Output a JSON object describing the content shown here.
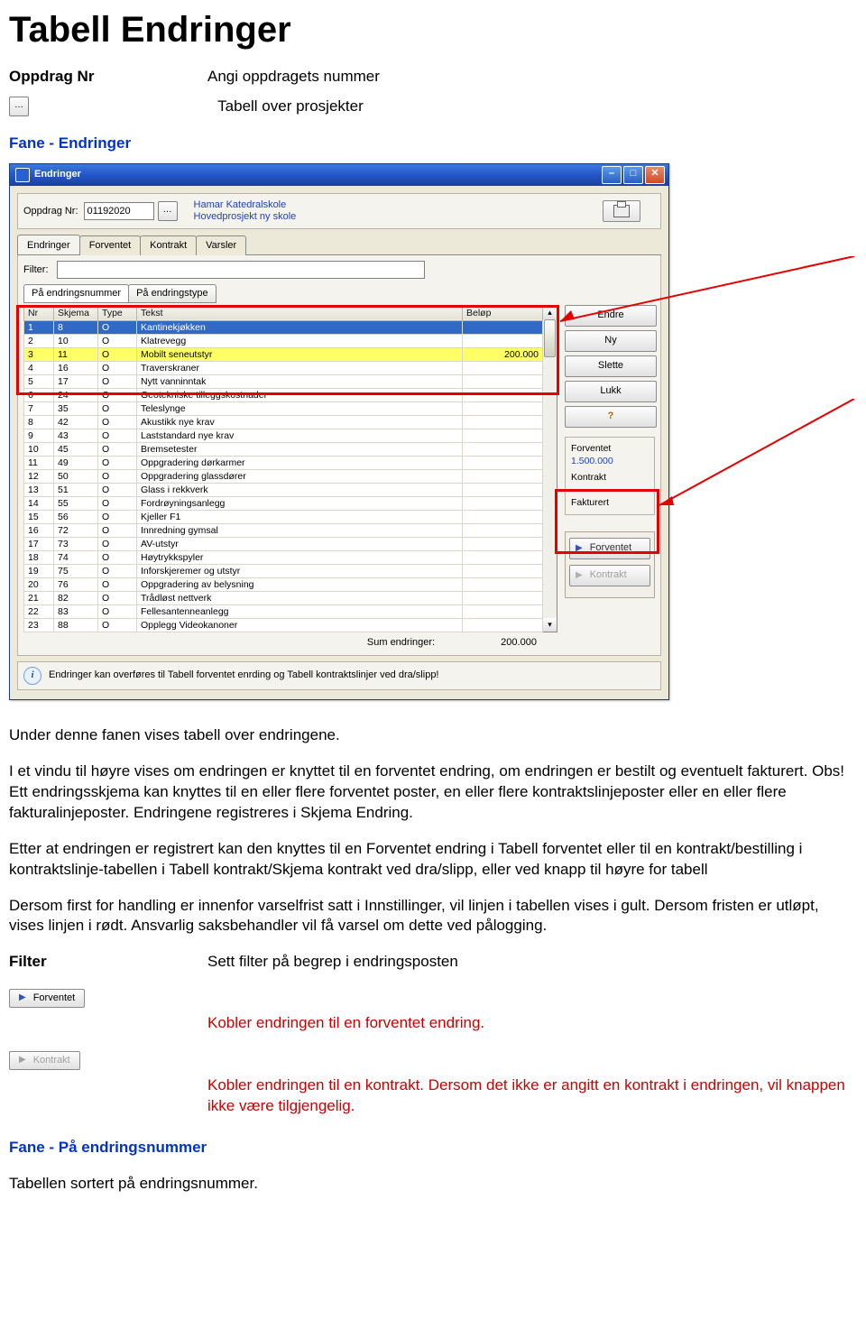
{
  "doc": {
    "title": "Tabell Endringer",
    "defs": {
      "oppdrag_label": "Oppdrag Nr",
      "oppdrag_desc": "Angi oppdragets nummer",
      "tabell_desc": "Tabell over prosjekter"
    },
    "section1_heading": "Fane - Endringer",
    "para1": "Under denne fanen vises tabell over endringene.",
    "para2": "I et vindu til høyre vises om endringen er knyttet til en forventet endring, om endringen er bestilt og eventuelt fakturert. Obs! Ett endringsskjema kan knyttes til en eller flere forventet poster, en eller flere kontraktslinjeposter eller en eller flere fakturalinjeposter. Endringene registreres i Skjema Endring.",
    "para3": "Etter at endringen er registrert kan den knyttes til en Forventet endring i Tabell forventet eller til en kontrakt/bestilling i kontraktslinje-tabellen i Tabell kontrakt/Skjema kontrakt ved dra/slipp, eller ved knapp til høyre for tabell",
    "para4": "Dersom first for handling er innenfor varselfrist satt i Innstillinger, vil linjen i tabellen vises i gult. Dersom fristen er utløpt, vises linjen i rødt. Ansvarlig saksbehandler vil få varsel om dette ved pålogging.",
    "filter_label": "Filter",
    "filter_desc": "Sett filter på begrep i endringsposten",
    "forventet_text": "Kobler endringen til en forventet endring.",
    "kontrakt_text": "Kobler endringen til en kontrakt. Dersom det ikke er angitt en kontrakt i endringen, vil knappen ikke være tilgjengelig.",
    "section2_heading": "Fane - På endringsnummer",
    "section2_text": "Tabellen sortert på endringsnummer.",
    "btn_forventet": "Forventet",
    "btn_kontrakt": "Kontrakt"
  },
  "win": {
    "title": "Endringer",
    "oppdrag_label": "Oppdrag Nr:",
    "oppdrag_value": "01192020",
    "project_line1": "Hamar Katedralskole",
    "project_line2": "Hovedprosjekt ny skole",
    "tabs": [
      "Endringer",
      "Forventet",
      "Kontrakt",
      "Varsler"
    ],
    "filter_label": "Filter:",
    "subtabs": [
      "På endringsnummer",
      "På endringstype"
    ],
    "columns": [
      "Nr",
      "Skjema",
      "Type",
      "Tekst",
      "Beløp"
    ],
    "rows": [
      {
        "nr": "1",
        "sk": "8",
        "ty": "O",
        "txt": "Kantinekjøkken",
        "bel": "",
        "sel": true
      },
      {
        "nr": "2",
        "sk": "10",
        "ty": "O",
        "txt": "Klatrevegg",
        "bel": ""
      },
      {
        "nr": "3",
        "sk": "11",
        "ty": "O",
        "txt": "Mobilt seneutstyr",
        "bel": "200.000",
        "hl": true
      },
      {
        "nr": "4",
        "sk": "16",
        "ty": "O",
        "txt": "Traverskraner",
        "bel": ""
      },
      {
        "nr": "5",
        "sk": "17",
        "ty": "O",
        "txt": "Nytt vanninntak",
        "bel": ""
      },
      {
        "nr": "6",
        "sk": "24",
        "ty": "O",
        "txt": "Geotekniske tilleggskostnader",
        "bel": ""
      },
      {
        "nr": "7",
        "sk": "35",
        "ty": "O",
        "txt": "Teleslynge",
        "bel": ""
      },
      {
        "nr": "8",
        "sk": "42",
        "ty": "O",
        "txt": "Akustikk nye krav",
        "bel": ""
      },
      {
        "nr": "9",
        "sk": "43",
        "ty": "O",
        "txt": "Laststandard nye krav",
        "bel": ""
      },
      {
        "nr": "10",
        "sk": "45",
        "ty": "O",
        "txt": "Bremsetester",
        "bel": ""
      },
      {
        "nr": "11",
        "sk": "49",
        "ty": "O",
        "txt": "Oppgradering dørkarmer",
        "bel": ""
      },
      {
        "nr": "12",
        "sk": "50",
        "ty": "O",
        "txt": "Oppgradering glassdører",
        "bel": ""
      },
      {
        "nr": "13",
        "sk": "51",
        "ty": "O",
        "txt": "Glass i rekkverk",
        "bel": ""
      },
      {
        "nr": "14",
        "sk": "55",
        "ty": "O",
        "txt": "Fordrøyningsanlegg",
        "bel": ""
      },
      {
        "nr": "15",
        "sk": "56",
        "ty": "O",
        "txt": "Kjeller F1",
        "bel": ""
      },
      {
        "nr": "16",
        "sk": "72",
        "ty": "O",
        "txt": "Innredning gymsal",
        "bel": ""
      },
      {
        "nr": "17",
        "sk": "73",
        "ty": "O",
        "txt": "AV-utstyr",
        "bel": ""
      },
      {
        "nr": "18",
        "sk": "74",
        "ty": "O",
        "txt": "Høytrykkspyler",
        "bel": ""
      },
      {
        "nr": "19",
        "sk": "75",
        "ty": "O",
        "txt": "Inforskjeremer og utstyr",
        "bel": ""
      },
      {
        "nr": "20",
        "sk": "76",
        "ty": "O",
        "txt": "Oppgradering av belysning",
        "bel": ""
      },
      {
        "nr": "21",
        "sk": "82",
        "ty": "O",
        "txt": "Trådløst nettverk",
        "bel": ""
      },
      {
        "nr": "22",
        "sk": "83",
        "ty": "O",
        "txt": "Fellesantenneanlegg",
        "bel": ""
      },
      {
        "nr": "23",
        "sk": "88",
        "ty": "O",
        "txt": "Opplegg Videokanoner",
        "bel": ""
      }
    ],
    "buttons": {
      "endre": "Endre",
      "ny": "Ny",
      "slette": "Slette",
      "lukk": "Lukk"
    },
    "summary": {
      "forventet_lbl": "Forventet",
      "forventet_val": "1.500.000",
      "kontrakt_lbl": "Kontrakt",
      "fakturert_lbl": "Fakturert"
    },
    "drag": {
      "forventet": "Forventet",
      "kontrakt": "Kontrakt"
    },
    "sum_label": "Sum endringer:",
    "sum_value": "200.000",
    "info_text": "Endringer kan overføres til Tabell forventet enrding og Tabell kontraktslinjer ved dra/slipp!"
  }
}
